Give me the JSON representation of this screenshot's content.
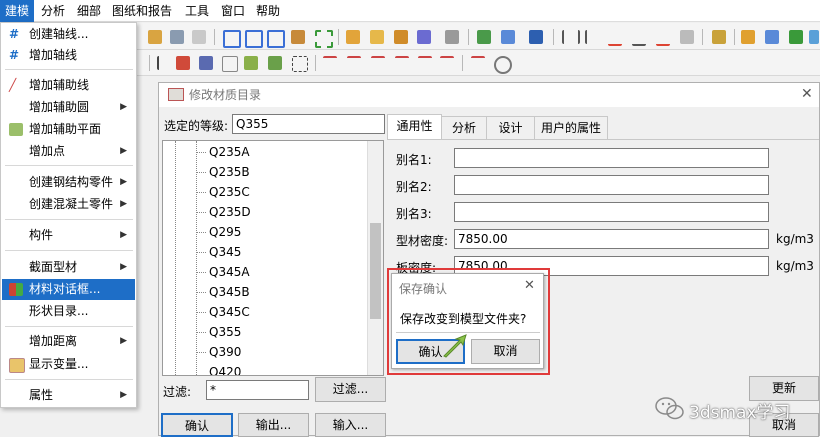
{
  "menubar": {
    "items": [
      "建模",
      "分析",
      "细部",
      "图纸和报告",
      "工具",
      "窗口",
      "帮助"
    ]
  },
  "dropdown": {
    "items": [
      {
        "label": "创建轴线...",
        "icon": "grid-create-icon"
      },
      {
        "label": "增加轴线",
        "icon": "grid-add-icon"
      },
      {
        "label": "增加辅助线",
        "icon": "construction-line-icon"
      },
      {
        "label": "增加辅助圆",
        "arrow": "▶"
      },
      {
        "label": "增加辅助平面",
        "icon": "construction-plane-icon"
      },
      {
        "label": "增加点",
        "arrow": "▶"
      },
      {
        "label": "创建钢结构零件",
        "arrow": "▶"
      },
      {
        "label": "创建混凝土零件",
        "arrow": "▶"
      },
      {
        "label": "构件",
        "arrow": "▶"
      },
      {
        "label": "截面型材",
        "arrow": "▶"
      },
      {
        "label": "材料对话框...",
        "icon": "material-catalog-icon"
      },
      {
        "label": "形状目录..."
      },
      {
        "label": "增加距离",
        "arrow": "▶"
      },
      {
        "label": "显示变量...",
        "icon": "variables-icon"
      },
      {
        "label": "属性",
        "arrow": "▶"
      }
    ]
  },
  "dialog": {
    "title": "修改材质目录",
    "close_glyph": "✕",
    "grade_label": "选定的等级:",
    "grade_value": "Q355",
    "tree_items": [
      "Q235A",
      "Q235B",
      "Q235C",
      "Q235D",
      "Q295",
      "Q345",
      "Q345A",
      "Q345B",
      "Q345C",
      "Q355",
      "Q390",
      "Q420"
    ],
    "filter_label": "过滤:",
    "filter_value": "*",
    "filter_button": "过滤...",
    "tabs": [
      "通用性",
      "分析",
      "设计",
      "用户的属性"
    ],
    "alias1_label": "别名1:",
    "alias2_label": "别名2:",
    "alias3_label": "别名3:",
    "profile_density_label": "型材密度:",
    "profile_density_value": "7850.00",
    "profile_density_unit": "kg/m3",
    "plate_density_label": "板密度:",
    "plate_density_value": "7850.00",
    "plate_density_unit": "kg/m3",
    "update_button": "更新",
    "ok_button": "确认",
    "export_button": "输出...",
    "import_button": "输入...",
    "cancel_button": "取消"
  },
  "confirm": {
    "title": "保存确认",
    "close_glyph": "✕",
    "message": "保存改变到模型文件夹?",
    "ok_button": "确认",
    "cancel_button": "取消",
    "highlight_color": "#e03a3a"
  },
  "watermark": {
    "text": "3dsmax学习"
  },
  "colors": {
    "menu_highlight": "#1e6ec7",
    "arrow_green": "#8bc34a"
  }
}
